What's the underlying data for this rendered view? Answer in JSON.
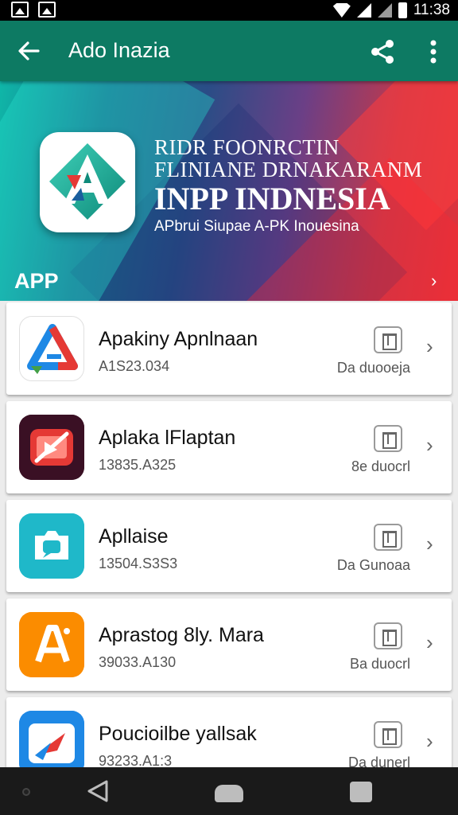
{
  "status_bar": {
    "time": "11:38"
  },
  "toolbar": {
    "title": "Ado Inazia"
  },
  "banner": {
    "line1": "RIDR FOONRCTIN",
    "line2": "FLINIANE DRNAKARANM",
    "line3": "INPP INDNESIA",
    "line4": "APbrui Siupae A-PK Inouesina",
    "section_label": "APP",
    "arrow": "›"
  },
  "apps": [
    {
      "name": "Apakiny Apnlnaan",
      "sub": "A1S23.034",
      "status": "Da duooeja",
      "icon": "delta-a-icon",
      "color": "#1a73e8"
    },
    {
      "name": "Aplaka lFlaptan",
      "sub": "13835.A325",
      "status": "8e duocrl",
      "icon": "video-slash-icon",
      "color": "#e53935"
    },
    {
      "name": "Apllaise",
      "sub": "13504.S3S3",
      "status": "Da Gunoaa",
      "icon": "camera-chat-icon",
      "color": "#19b5c7"
    },
    {
      "name": "Aprastog 8ly. Mara",
      "sub": "39033.A130",
      "status": "Ba duocrl",
      "icon": "letter-a-icon",
      "color": "#fb8c00"
    },
    {
      "name": "Poucioilbe yallsak",
      "sub": "93233.A1:3",
      "status": "Da dunerl",
      "icon": "plane-icon",
      "color": "#1e88e5"
    }
  ],
  "chevron": "›"
}
